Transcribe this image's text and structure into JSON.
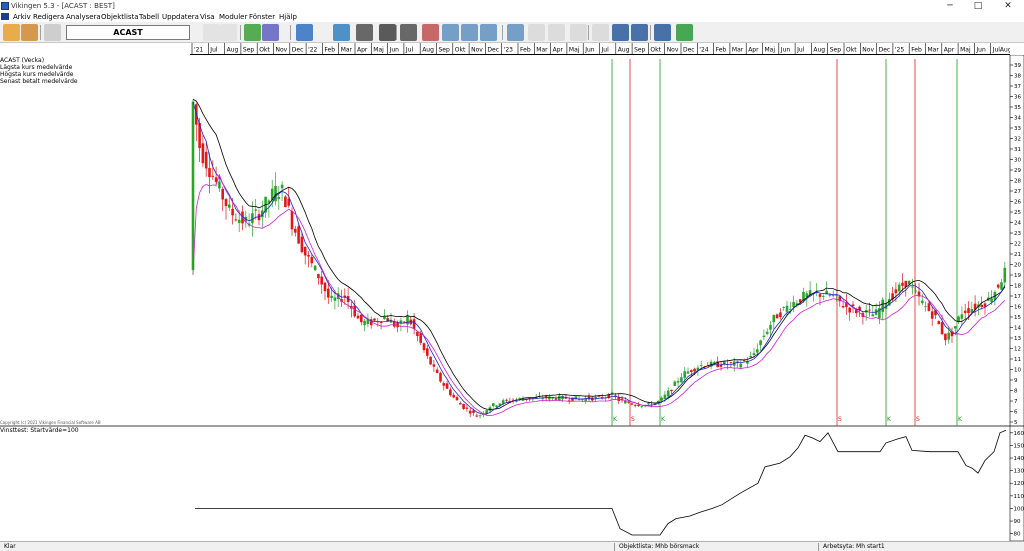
{
  "window": {
    "title": "Vikingen 5.3 - [ACAST : BEST]",
    "min_icon": "─",
    "max_icon": "□",
    "close_icon": "✕"
  },
  "menu": [
    "Arkiv",
    "Redigera",
    "Analysera",
    "Objektlista",
    "Tabell",
    "Uppdatera",
    "Visa",
    "Moduler",
    "Fönster",
    "Hjälp"
  ],
  "toolbar": {
    "symbol": "ACAST",
    "button_icons": [
      "open-folder-icon",
      "print-icon",
      "notepad-icon",
      "document-icon",
      "document-edit-icon",
      "chart-lines-icon",
      "trend-icon",
      "antenna-icon",
      "globe-arrow-icon",
      "camera-icon",
      "print-icon",
      "print-icon",
      "palette-icon",
      "window-icon",
      "window-icon",
      "window-icon",
      "window-icon",
      "window-icon",
      "window-icon",
      "window-icon",
      "window-icon",
      "candlestick-icon",
      "bars-icon",
      "curve-icon",
      "globe-icon",
      "money-icon"
    ]
  },
  "time_axis": {
    "labels": [
      "'21",
      "Jul",
      "Aug",
      "Sep",
      "Okt",
      "Nov",
      "Dec",
      "'22",
      "Feb",
      "Mar",
      "Apr",
      "Maj",
      "Jun",
      "Jul",
      "Aug",
      "Sep",
      "Okt",
      "Nov",
      "Dec",
      "'23",
      "Feb",
      "Mar",
      "Apr",
      "Maj",
      "Jun",
      "Jul",
      "Aug",
      "Sep",
      "Okt",
      "Nov",
      "Dec",
      "'24",
      "Feb",
      "Mar",
      "Apr",
      "Maj",
      "Jun",
      "Jul",
      "Aug",
      "Sep",
      "Okt",
      "Nov",
      "Dec",
      "'25",
      "Feb",
      "Mar",
      "Apr",
      "Maj",
      "Jun",
      "JulAug"
    ]
  },
  "legend": {
    "lines": [
      "ACAST (Vecka)",
      "Lägsta kurs medelvärde",
      "Högsta kurs medelvärde",
      "Senast betalt medelvärde"
    ],
    "vinst_label": "Vinsttest: Startvärde=100"
  },
  "copyright": "Copyright (c) 2021 Vikingen Financial Software AB",
  "price_axis": {
    "ticks": [
      "39",
      "38",
      "37",
      "36",
      "35",
      "34",
      "33",
      "32",
      "31",
      "30",
      "29",
      "28",
      "27",
      "26",
      "25",
      "24",
      "23",
      "22",
      "21",
      "20",
      "19",
      "18",
      "17",
      "16",
      "15",
      "14",
      "13",
      "12",
      "11",
      "10",
      "9",
      "8",
      "7",
      "6",
      "5"
    ],
    "range": [
      5,
      39
    ]
  },
  "vinst_axis": {
    "ticks": [
      "160",
      "150",
      "140",
      "130",
      "120",
      "110",
      "100",
      "90",
      "80"
    ],
    "range": [
      75,
      163
    ]
  },
  "signals": [
    {
      "label": "K",
      "type": "buy",
      "color": "#1a9e1a",
      "date": "Aug 2023"
    },
    {
      "label": "S",
      "type": "sell",
      "color": "#e02020",
      "date": "Sep 2023"
    },
    {
      "label": "K",
      "type": "buy",
      "color": "#1a9e1a",
      "date": "Nov 2023"
    },
    {
      "label": "S",
      "type": "sell",
      "color": "#e02020",
      "date": "Okt 2024"
    },
    {
      "label": "K",
      "type": "buy",
      "color": "#1a9e1a",
      "date": "Jan 2025"
    },
    {
      "label": "S",
      "type": "sell",
      "color": "#e02020",
      "date": "Feb 2025"
    },
    {
      "label": "K",
      "type": "buy",
      "color": "#1a9e1a",
      "date": "Maj 2025"
    }
  ],
  "colors": {
    "up_candle": "#2aa52a",
    "down_candle": "#e01818",
    "ma_black": "#000000",
    "ma_blue": "#2020d0",
    "ma_magenta": "#d020d0"
  },
  "status": {
    "left": "Klar",
    "middle": "Objektlista: Mhb börsmack",
    "right": "Arbetsyta: Mh start1"
  }
}
